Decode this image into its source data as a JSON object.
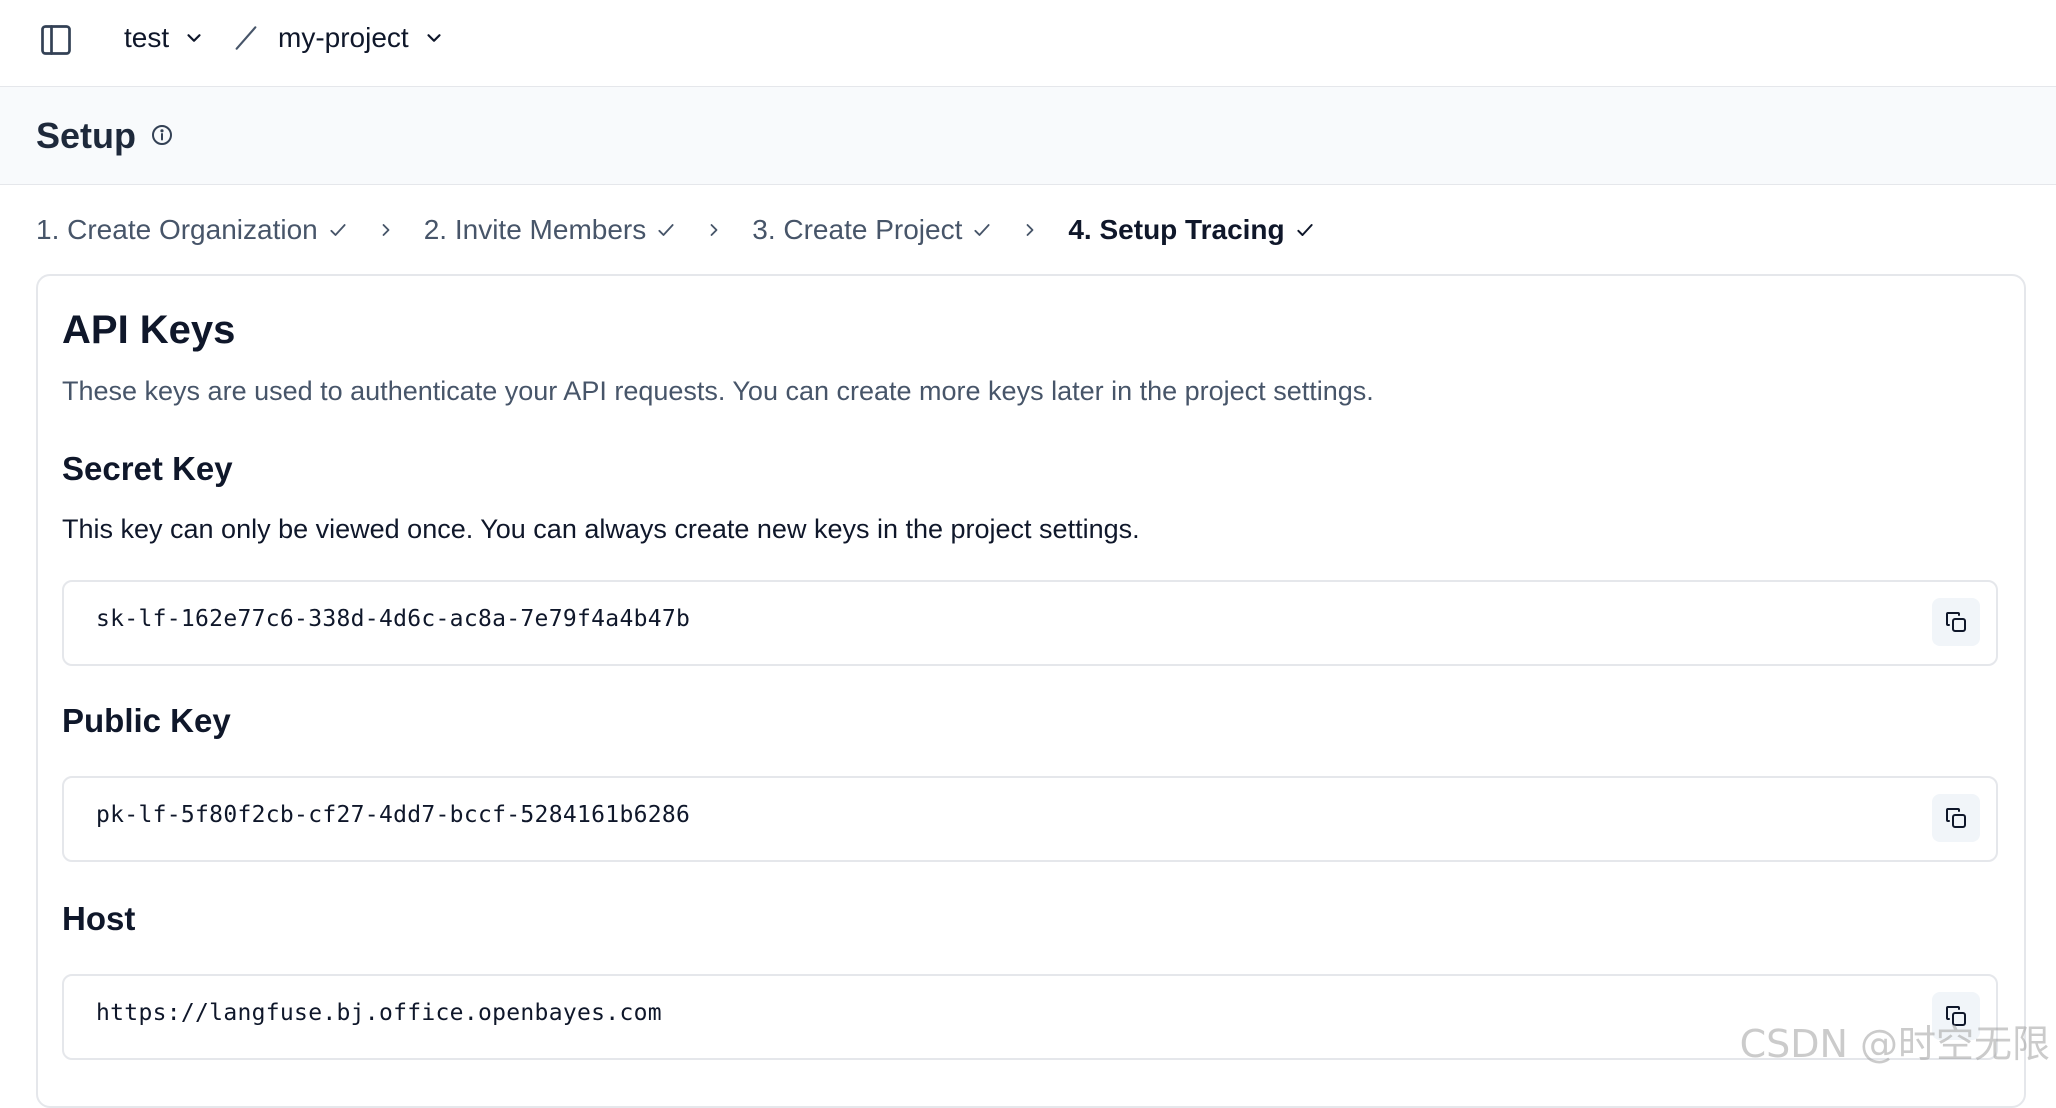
{
  "nav": {
    "org": "test",
    "project": "my-project"
  },
  "page": {
    "title": "Setup"
  },
  "steps": [
    {
      "label": "1. Create Organization"
    },
    {
      "label": "2. Invite Members"
    },
    {
      "label": "3. Create Project"
    },
    {
      "label": "4. Setup Tracing"
    }
  ],
  "api_keys": {
    "title": "API Keys",
    "description": "These keys are used to authenticate your API requests. You can create more keys later in the project settings.",
    "secret": {
      "title": "Secret Key",
      "note": "This key can only be viewed once. You can always create new keys in the project settings.",
      "value": "sk-lf-162e77c6-338d-4d6c-ac8a-7e79f4a4b47b"
    },
    "public": {
      "title": "Public Key",
      "value": "pk-lf-5f80f2cb-cf27-4dd7-bccf-5284161b6286"
    },
    "host": {
      "title": "Host",
      "value": "https://langfuse.bj.office.openbayes.com"
    }
  },
  "watermark": "CSDN @时空无限",
  "icons": {
    "sidebar_toggle": "panel-left-icon",
    "info": "info-icon",
    "chevron": "chevron-down-icon",
    "step_done": "check-icon",
    "step_sep": "chevron-right-icon",
    "copy": "copy-icon"
  },
  "colors": {
    "primary_text": "#0f172a",
    "muted_text": "#475569",
    "border": "#e5e7eb",
    "header_bg": "#f8fafc"
  }
}
